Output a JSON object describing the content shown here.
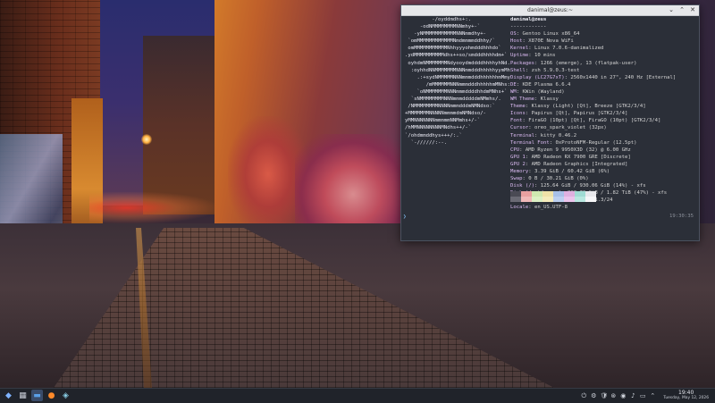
{
  "terminal": {
    "title": "danimal@zeus:~",
    "controls": {
      "minimize": "⌄",
      "maximize": "⌃",
      "close": "✕"
    },
    "logo": [
      "         -/oyddmdhs+:.",
      "     -odNMMMMMMMMNNmhy+-`",
      "   -yNMMMMMMMMMMMNNNmmdhy+-",
      " `omMMMMMMMMMMMMNmdmmmmddhhy/`",
      " omMMMMMMMMMMMNhhyyyohmdddhhhdo`",
      ".ydMMMMMMMMMMdhs++so/smdddhhhhdm+`",
      " oyhdmNMMMMMMMNdyooydmddddhhhhyhNd.",
      "  :oyhhdNNMMMMMMMNNNmmdddhhhhhyymMh",
      "    .:+sydNMMMMMNNNmmmdddhhhhhhmMmy",
      "       /mMMMMMMNNNmmmdddhhhhhmMNhs:",
      "    `oNMMMMMMMNNNmmmddddhhdmMNhs+`",
      "  `sNMMMMMMMMNNNmmmdddddmNMmhs/.",
      " /NMMMMMMMMNNNNmmmdddmNMNdso:`",
      "+MMMMMMMNNNNNmmmmdmNMNdso/-",
      "yMMNNNNNNNmmmmmNNMmhs+/-`",
      "/hMMNNNNNNNNMNdhs++/-`",
      "`/ohdmmddhys+++/:.`",
      "  `-//////:--."
    ],
    "header": "danimal@zeus",
    "separator": "------------",
    "info": [
      {
        "key": "OS",
        "value": "Gentoo Linux x86_64"
      },
      {
        "key": "Host",
        "value": "X870E Nova WiFi"
      },
      {
        "key": "Kernel",
        "value": "Linux 7.0.6-danimalized"
      },
      {
        "key": "Uptime",
        "value": "10 mins"
      },
      {
        "key": "Packages",
        "value": "1266 (emerge), 13 (flatpak-user)"
      },
      {
        "key": "Shell",
        "value": "zsh 5.9.0.3-test"
      },
      {
        "key": "Display (LC27G7xT)",
        "value": "2560x1440 in 27\", 240 Hz [External]"
      },
      {
        "key": "DE",
        "value": "KDE Plasma 6.6.4"
      },
      {
        "key": "WM",
        "value": "KWin (Wayland)"
      },
      {
        "key": "WM Theme",
        "value": "Klassy"
      },
      {
        "key": "Theme",
        "value": "Klassy (Light) [Qt], Breeze [GTK2/3/4]"
      },
      {
        "key": "Icons",
        "value": "Papirus [Qt], Papirus [GTK2/3/4]"
      },
      {
        "key": "Font",
        "value": "FiraGO (10pt) [Qt], FiraGO (10pt) [GTK2/3/4]"
      },
      {
        "key": "Cursor",
        "value": "oreo_spark_violet (32px)"
      },
      {
        "key": "Terminal",
        "value": "kitty 0.46.2"
      },
      {
        "key": "Terminal Font",
        "value": "0xProtoNFM-Regular (12.5pt)"
      },
      {
        "key": "CPU",
        "value": "AMD Ryzen 9 9950X3D (32) @ 6.00 GHz"
      },
      {
        "key": "GPU 1",
        "value": "AMD Radeon RX 7900 GRE [Discrete]"
      },
      {
        "key": "GPU 2",
        "value": "AMD Radeon Graphics [Integrated]"
      },
      {
        "key": "Memory",
        "value": "3.39 GiB / 60.42 GiB (6%)"
      },
      {
        "key": "Swap",
        "value": "0 B / 30.21 GiB (0%)"
      },
      {
        "key": "Disk (/)",
        "value": "125.64 GiB / 930.06 GiB (14%) - xfs"
      },
      {
        "key": "Disk (/mnt/games)",
        "value": "883.73 GiB / 1.82 TiB (47%) - xfs"
      },
      {
        "key": "Local IP (enp10s0)",
        "value": "192.168.1.3/24"
      },
      {
        "key": "Locale",
        "value": "en_US.UTF-8"
      }
    ],
    "palette_top": [
      "#4a4a54",
      "#e8a0a0",
      "#cfe8b0",
      "#f0e2a8",
      "#a8c0e8",
      "#e0b0e0",
      "#a0dcd4",
      "#e8e8ec"
    ],
    "palette_bottom": [
      "#6a6a74",
      "#f0b8b8",
      "#dcf0c4",
      "#f6ecbc",
      "#bccff0",
      "#ecc4ec",
      "#b8e8e0",
      "#f6f6f8"
    ],
    "prompt": "❯",
    "time": "19:30:35"
  },
  "taskbar": {
    "apps": [
      {
        "name": "app-launcher",
        "glyph": "◆",
        "color": "#7fb3ff"
      },
      {
        "name": "pager",
        "glyph": "▦",
        "color": "#c8ccd6"
      },
      {
        "name": "file-manager",
        "glyph": "▬",
        "color": "#5aa0e8"
      },
      {
        "name": "firefox",
        "glyph": "●",
        "color": "#ff8a2a"
      },
      {
        "name": "kitty",
        "glyph": "◈",
        "color": "#8ad0e8"
      }
    ],
    "tray": [
      "⏻",
      "⚙",
      "🛡",
      "⊛",
      "◉",
      "♪",
      "▭",
      "⌃"
    ],
    "clock_time": "19:40",
    "clock_date": "Tuesday, May 12, 2026",
    "accent": "#3a4c6a"
  }
}
